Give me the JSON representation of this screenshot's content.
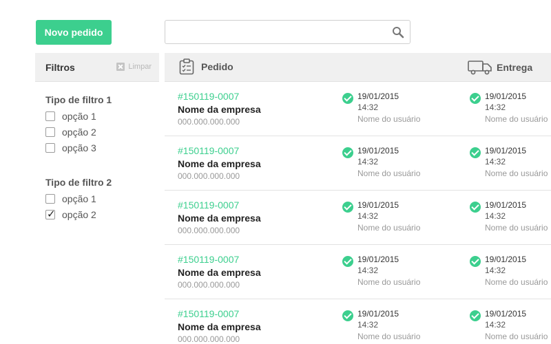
{
  "toolbar": {
    "new_order_label": "Novo pedido"
  },
  "search": {
    "value": "",
    "placeholder": ""
  },
  "sidebar": {
    "title": "Filtros",
    "clear_label": "Limpar",
    "groups": [
      {
        "title": "Tipo de filtro 1",
        "options": [
          {
            "label": "opção 1",
            "checked": false
          },
          {
            "label": "opção 2",
            "checked": false
          },
          {
            "label": "opção 3",
            "checked": false
          }
        ]
      },
      {
        "title": "Tipo de filtro 2",
        "options": [
          {
            "label": "opção 1",
            "checked": false
          },
          {
            "label": "opção 2",
            "checked": true
          }
        ]
      }
    ]
  },
  "table": {
    "columns": {
      "order": "Pedido",
      "delivery": "Entrega"
    },
    "rows": [
      {
        "id": "#150119-0007",
        "company": "Nome da empresa",
        "document": "000.000.000.000",
        "order_status": {
          "date": "19/01/2015",
          "time": "14:32",
          "user": "Nome do usuário"
        },
        "delivery_status": {
          "date": "19/01/2015",
          "time": "14:32",
          "user": "Nome do usuário"
        }
      },
      {
        "id": "#150119-0007",
        "company": "Nome da empresa",
        "document": "000.000.000.000",
        "order_status": {
          "date": "19/01/2015",
          "time": "14:32",
          "user": "Nome do usuário"
        },
        "delivery_status": {
          "date": "19/01/2015",
          "time": "14:32",
          "user": "Nome do usuário"
        }
      },
      {
        "id": "#150119-0007",
        "company": "Nome da empresa",
        "document": "000.000.000.000",
        "order_status": {
          "date": "19/01/2015",
          "time": "14:32",
          "user": "Nome do usuário"
        },
        "delivery_status": {
          "date": "19/01/2015",
          "time": "14:32",
          "user": "Nome do usuário"
        }
      },
      {
        "id": "#150119-0007",
        "company": "Nome da empresa",
        "document": "000.000.000.000",
        "order_status": {
          "date": "19/01/2015",
          "time": "14:32",
          "user": "Nome do usuário"
        },
        "delivery_status": {
          "date": "19/01/2015",
          "time": "14:32",
          "user": "Nome do usuário"
        }
      },
      {
        "id": "#150119-0007",
        "company": "Nome da empresa",
        "document": "000.000.000.000",
        "order_status": {
          "date": "19/01/2015",
          "time": "14:32",
          "user": "Nome do usuário"
        },
        "delivery_status": {
          "date": "19/01/2015",
          "time": "14:32",
          "user": "Nome do usuário"
        }
      }
    ]
  },
  "icons": {
    "search": "search-icon",
    "clear": "clear-icon",
    "order": "clipboard-icon",
    "delivery": "truck-icon",
    "status": "check-circle-icon"
  },
  "colors": {
    "accent": "#3ccf8e",
    "header_bg": "#f0f0f0"
  }
}
